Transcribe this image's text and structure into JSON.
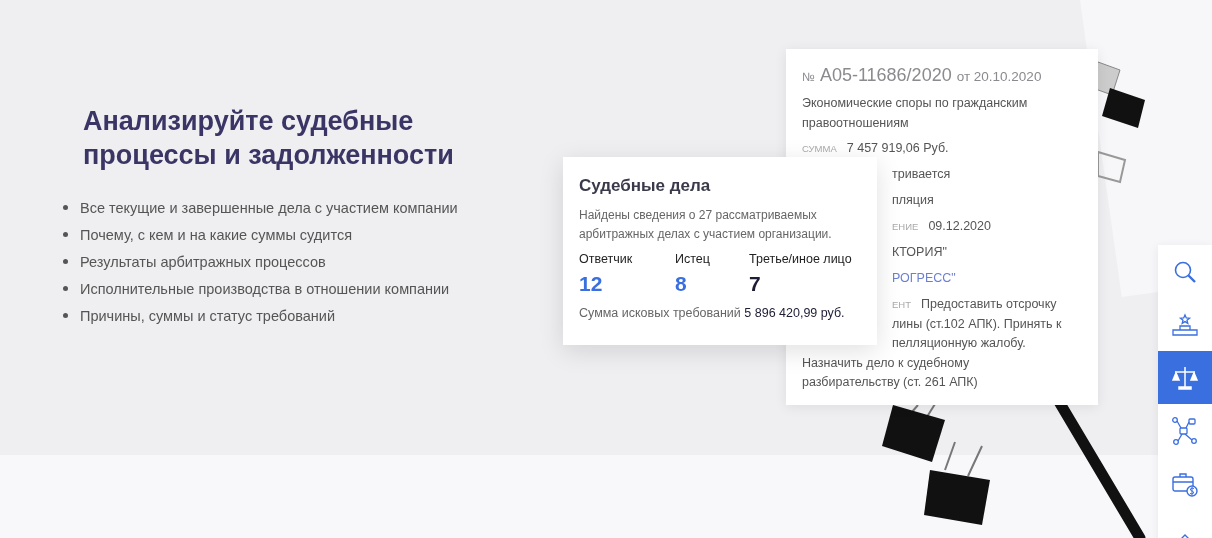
{
  "hero": {
    "title": "Анализируйте судебные процессы и задолженности",
    "bullets": [
      "Все текущие и завершенные дела с участием компании",
      "Почему, с кем и на какие суммы судится",
      "Результаты арбитражных процессов",
      "Исполнительные производства в отношении компании",
      "Причины, суммы и статус требований"
    ]
  },
  "case_card": {
    "number_sign": "№",
    "number": "А05-11686/2020",
    "date": "от 20.10.2020",
    "rows": [
      {
        "kind": "text",
        "text": "Экономические споры по гражданским правоотношениям"
      },
      {
        "kind": "field",
        "label": "СУММА",
        "value": "7 457 919,06 Руб."
      },
      {
        "kind": "clipped",
        "text": "тривается"
      },
      {
        "kind": "clipped",
        "text": "пляция"
      },
      {
        "kind": "clipped_field",
        "label": "ЕНИЕ",
        "value": "09.12.2020"
      },
      {
        "kind": "clipped",
        "text": "КТОРИЯ\""
      },
      {
        "kind": "clipped_link",
        "text": "РОГРЕСС\""
      },
      {
        "kind": "clipped_field",
        "label": "ЕНТ",
        "value": "Предоставить отсрочку"
      },
      {
        "kind": "clipped",
        "text": "лины (ст.102 АПК). Принять к"
      },
      {
        "kind": "clipped",
        "text": "пелляционную жалобу."
      },
      {
        "kind": "text",
        "text": "Назначить дело к судебному"
      },
      {
        "kind": "text",
        "text": "разбирательству (ст. 261 АПК)"
      }
    ]
  },
  "cases_card": {
    "title": "Судебные дела",
    "description": "Найдены сведения о 27 рассматриваемых арбитражных делах с участием организации.",
    "stats": [
      {
        "label": "Ответчик",
        "value": "12",
        "color": "#3a6fe0"
      },
      {
        "label": "Истец",
        "value": "8",
        "color": "#3a6fe0"
      },
      {
        "label": "Третье/иное лицо",
        "value": "7",
        "color": "#1d1d35"
      }
    ],
    "total": "Сумма исковых требований **5 896 420,99 руб.**"
  },
  "side_menu": [
    {
      "kind": "search",
      "selected": false
    },
    {
      "kind": "award",
      "selected": false
    },
    {
      "kind": "scales",
      "selected": true
    },
    {
      "kind": "flow",
      "selected": false
    },
    {
      "kind": "briefcase",
      "selected": false
    },
    {
      "kind": "partial",
      "selected": false
    }
  ]
}
